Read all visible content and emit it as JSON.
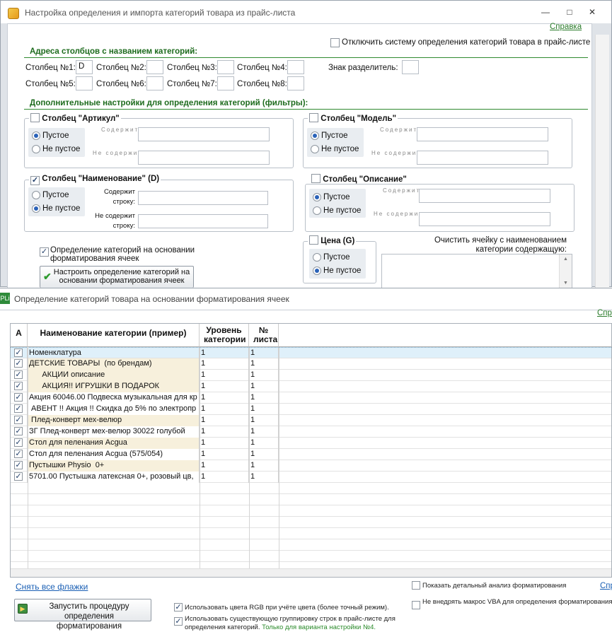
{
  "settings_window": {
    "title": "Настройка определения и импорта категорий товара из прайс-листа",
    "help_link": "Справка",
    "disable_system_label": "Отключить систему определения категорий товара в прайс-листе",
    "columns_header": "Адреса столбцов с названием категорий:",
    "columns": [
      {
        "label": "Столбец №1:",
        "value": "D"
      },
      {
        "label": "Столбец №2:",
        "value": ""
      },
      {
        "label": "Столбец №3:",
        "value": ""
      },
      {
        "label": "Столбец №4:",
        "value": ""
      },
      {
        "label": "Столбец №5:",
        "value": ""
      },
      {
        "label": "Столбец №6:",
        "value": ""
      },
      {
        "label": "Столбец №7:",
        "value": ""
      },
      {
        "label": "Столбец №8:",
        "value": ""
      }
    ],
    "separator_label": "Знак разделитель:",
    "separator_value": "",
    "filters_header": "Дополнительные настройки для определения категорий (фильтры):",
    "groups": {
      "article": {
        "title": "Столбец \"Артикул\"",
        "checked": false,
        "empty": "Пустое",
        "not_empty": "Не пустое",
        "selected": "empty",
        "contains": "Содержит",
        "not_contains": "Не содержит"
      },
      "model": {
        "title": "Столбец \"Модель\"",
        "checked": false,
        "empty": "Пустое",
        "not_empty": "Не пустое",
        "selected": "empty",
        "contains": "Содержит",
        "not_contains": "Не содержит"
      },
      "name": {
        "title": "Столбец \"Наименование\" (D)",
        "checked": true,
        "empty": "Пустое",
        "not_empty": "Не пустое",
        "selected": "not_empty",
        "contains": "Содержит строку:",
        "not_contains": "Не содержит строку:"
      },
      "description": {
        "title": "Столбец \"Описание\"",
        "checked": false,
        "empty": "Пустое",
        "not_empty": "Не пустое",
        "selected": "empty",
        "contains": "Содержит",
        "not_contains": "Не содержит"
      },
      "price": {
        "title": "Цена (G)",
        "checked": false,
        "empty": "Пустое",
        "not_empty": "Не пустое",
        "selected": "not_empty"
      }
    },
    "formatting_checkbox_label": "Определение категорий на основании форматирования ячеек",
    "formatting_checked": true,
    "configure_button": "Настроить определение категорий на основании форматирования ячеек",
    "clear_cell_label": "Очистить ячейку с наименованием категории содержащую:"
  },
  "formatting_window": {
    "title": "Определение категорий товара на основании форматирования ячеек",
    "help_link": "Справка",
    "app_badge": "PLi",
    "columns": {
      "a": "А",
      "name": "Наименование категории (пример)",
      "level": "Уровень категории",
      "sheet": "№ листа"
    },
    "rows": [
      {
        "checked": true,
        "name": "Номенклатура",
        "level": "1",
        "sheet": "1",
        "style": "selected"
      },
      {
        "checked": true,
        "name": "ДЕТСКИЕ ТОВАРЫ  (по брендам)",
        "level": "1",
        "sheet": "1",
        "style": "cream"
      },
      {
        "checked": true,
        "name": "      АКЦИИ описание",
        "level": "1",
        "sheet": "1",
        "style": "cream"
      },
      {
        "checked": true,
        "name": "      АКЦИЯ!! ИГРУШКИ В ПОДАРОК",
        "level": "1",
        "sheet": "1",
        "style": "cream"
      },
      {
        "checked": true,
        "name": "Акция 60046.00 Подвеска музыкальная для кр",
        "level": "1",
        "sheet": "1",
        "style": "plain"
      },
      {
        "checked": true,
        "name": " АВЕНТ !! Акция !! Скидка до 5% по электропр",
        "level": "1",
        "sheet": "1",
        "style": "plain"
      },
      {
        "checked": true,
        "name": " Плед-конверт мех-велюр",
        "level": "1",
        "sheet": "1",
        "style": "cream"
      },
      {
        "checked": true,
        "name": "ЗГ Плед-конверт мех-велюр 30022 голубой",
        "level": "1",
        "sheet": "1",
        "style": "plain"
      },
      {
        "checked": true,
        "name": "Стол для пеленания Acgua",
        "level": "1",
        "sheet": "1",
        "style": "cream"
      },
      {
        "checked": true,
        "name": "Стол для пеленания Acgua (575/054)",
        "level": "1",
        "sheet": "1",
        "style": "plain"
      },
      {
        "checked": true,
        "name": "Пустышки Physio  0+",
        "level": "1",
        "sheet": "1",
        "style": "cream"
      },
      {
        "checked": true,
        "name": "5701.00 Пустышка латексная 0+, розовый цв,",
        "level": "1",
        "sheet": "1",
        "style": "plain"
      }
    ],
    "clear_all_link": "Снять все флажки",
    "run_button": "Запустить процедуру определения форматирования",
    "use_rgb_label": "Использовать цвета RGB при учёте цвета (более точный режим).",
    "use_rgb_checked": true,
    "use_grouping_label": "Использовать существующую группировку строк в прайс-листе для определения категорий.",
    "use_grouping_note": "Только для варианта настройки №4.",
    "use_grouping_checked": true,
    "show_analysis_label": "Показать детальный анализ форматирования",
    "show_analysis_checked": false,
    "no_vba_label": "Не внедрять макрос VBA для определения форматирования, использовать прямой перебор (медленнее)",
    "no_vba_checked": false,
    "help_link_bottom": "Спр"
  },
  "colors": {
    "green_link": "#2a7b2a",
    "header_green": "#1d6b1d",
    "cream_row": "#f7f0dc",
    "selected_row": "#dff0fa"
  }
}
